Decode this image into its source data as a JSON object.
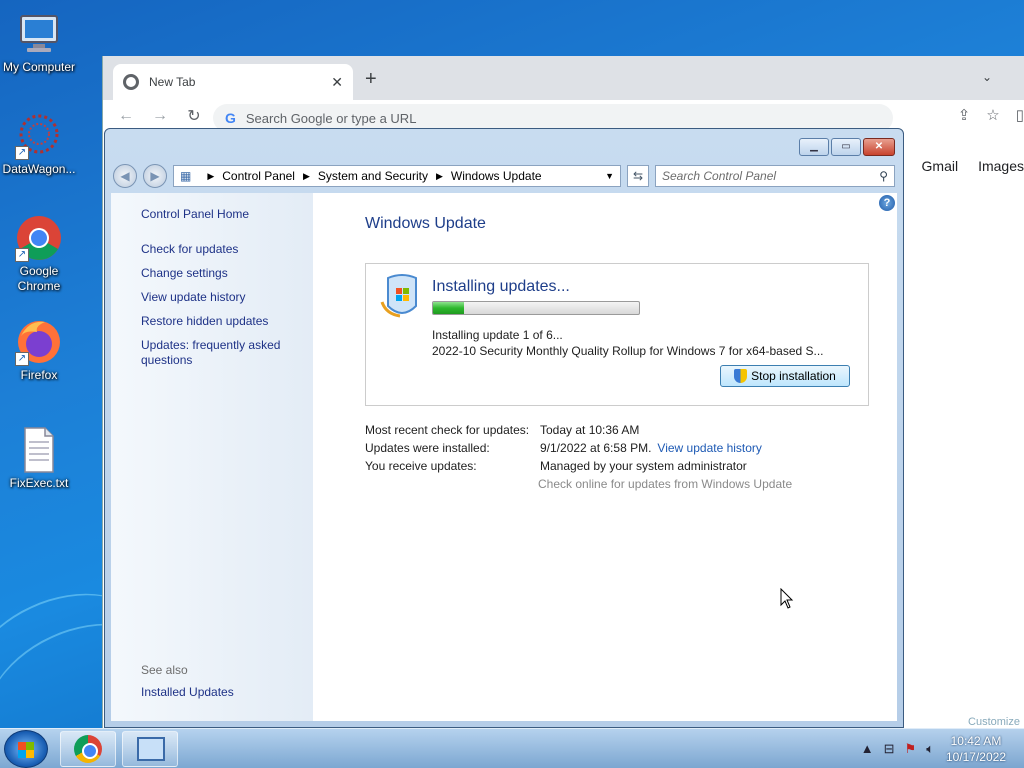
{
  "desktop": {
    "icons": [
      {
        "label": "My Computer"
      },
      {
        "label": "DataWagon..."
      },
      {
        "label": "Google Chrome"
      },
      {
        "label": "Firefox"
      },
      {
        "label": "FixExec.txt"
      }
    ]
  },
  "chrome": {
    "tab_title": "New Tab",
    "omnibox_placeholder": "Search Google or type a URL",
    "links": [
      "Gmail",
      "Images"
    ],
    "customize_hint": "Customize"
  },
  "control_panel": {
    "breadcrumb": [
      "Control Panel",
      "System and Security",
      "Windows Update"
    ],
    "search_placeholder": "Search Control Panel",
    "left_nav": {
      "home": "Control Panel Home",
      "items": [
        "Check for updates",
        "Change settings",
        "View update history",
        "Restore hidden updates",
        "Updates: frequently asked questions"
      ],
      "see_also_label": "See also",
      "see_also_items": [
        "Installed Updates"
      ]
    },
    "page_title": "Windows Update",
    "status": {
      "heading": "Installing updates...",
      "progress_percent": 15,
      "line1": "Installing update 1 of 6...",
      "line2": "2022-10 Security Monthly Quality Rollup for Windows 7 for x64-based S...",
      "stop_button": "Stop installation"
    },
    "info": {
      "recent_check_label": "Most recent check for updates:",
      "recent_check_value": "Today at 10:36 AM",
      "installed_label": "Updates were installed:",
      "installed_value": "9/1/2022 at 6:58 PM.",
      "installed_link": "View update history",
      "receive_label": "You receive updates:",
      "receive_value": "Managed by your system administrator",
      "check_online": "Check online for updates from Windows Update"
    }
  },
  "taskbar": {
    "time": "10:42 AM",
    "date": "10/17/2022"
  },
  "colors": {
    "link": "#1e3287",
    "title_blue": "#1e3e8a",
    "progress_green": "#2eb82e"
  }
}
